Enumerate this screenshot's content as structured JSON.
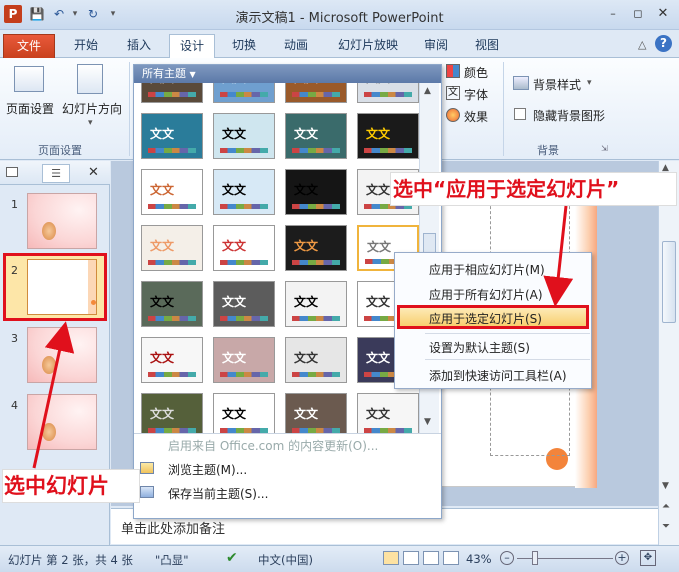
{
  "window": {
    "title": "演示文稿1 - Microsoft PowerPoint"
  },
  "quick_access": {
    "app_icon": "P",
    "save_icon": "save-icon",
    "undo_icon": "undo-icon",
    "redo_icon": "redo-icon"
  },
  "tabs": [
    "文件",
    "开始",
    "插入",
    "设计",
    "切换",
    "动画",
    "幻灯片放映",
    "审阅",
    "视图"
  ],
  "active_tab": "设计",
  "ribbon": {
    "page_setup": "页面设置",
    "slide_orientation": "幻灯片方向",
    "group_page_setup": "页面设置",
    "colors": "颜色",
    "fonts": "字体",
    "effects": "效果",
    "background_styles": "背景样式",
    "hide_background": "隐藏背景图形",
    "group_background": "背景"
  },
  "gallery": {
    "header": "所有主题",
    "tile_text": "文文",
    "enable_office_updates": "启用来自 Office.com 的内容更新(O)...",
    "browse_themes": "浏览主题(M)...",
    "save_current_theme": "保存当前主题(S)..."
  },
  "context_menu": {
    "items": [
      "应用于相应幻灯片(M)",
      "应用于所有幻灯片(A)",
      "应用于选定幻灯片(S)",
      "设置为默认主题(S)",
      "添加到快速访问工具栏(A)"
    ],
    "highlighted_index": 2
  },
  "slides": {
    "numbers": [
      "1",
      "2",
      "3",
      "4"
    ],
    "selected": "2"
  },
  "notes": {
    "placeholder": "单击此处添加备注"
  },
  "status": {
    "slide_info": "幻灯片 第 2 张，共 4 张",
    "theme": "\"凸显\"",
    "language": "中文(中国)",
    "zoom": "43%"
  },
  "annotations": {
    "top": "选中“应用于选定幻灯片”",
    "bottom": "选中幻灯片"
  },
  "colors": {
    "file_tab": "#d24726",
    "annotation": "#e0101c",
    "highlight": "#fbd98a"
  }
}
